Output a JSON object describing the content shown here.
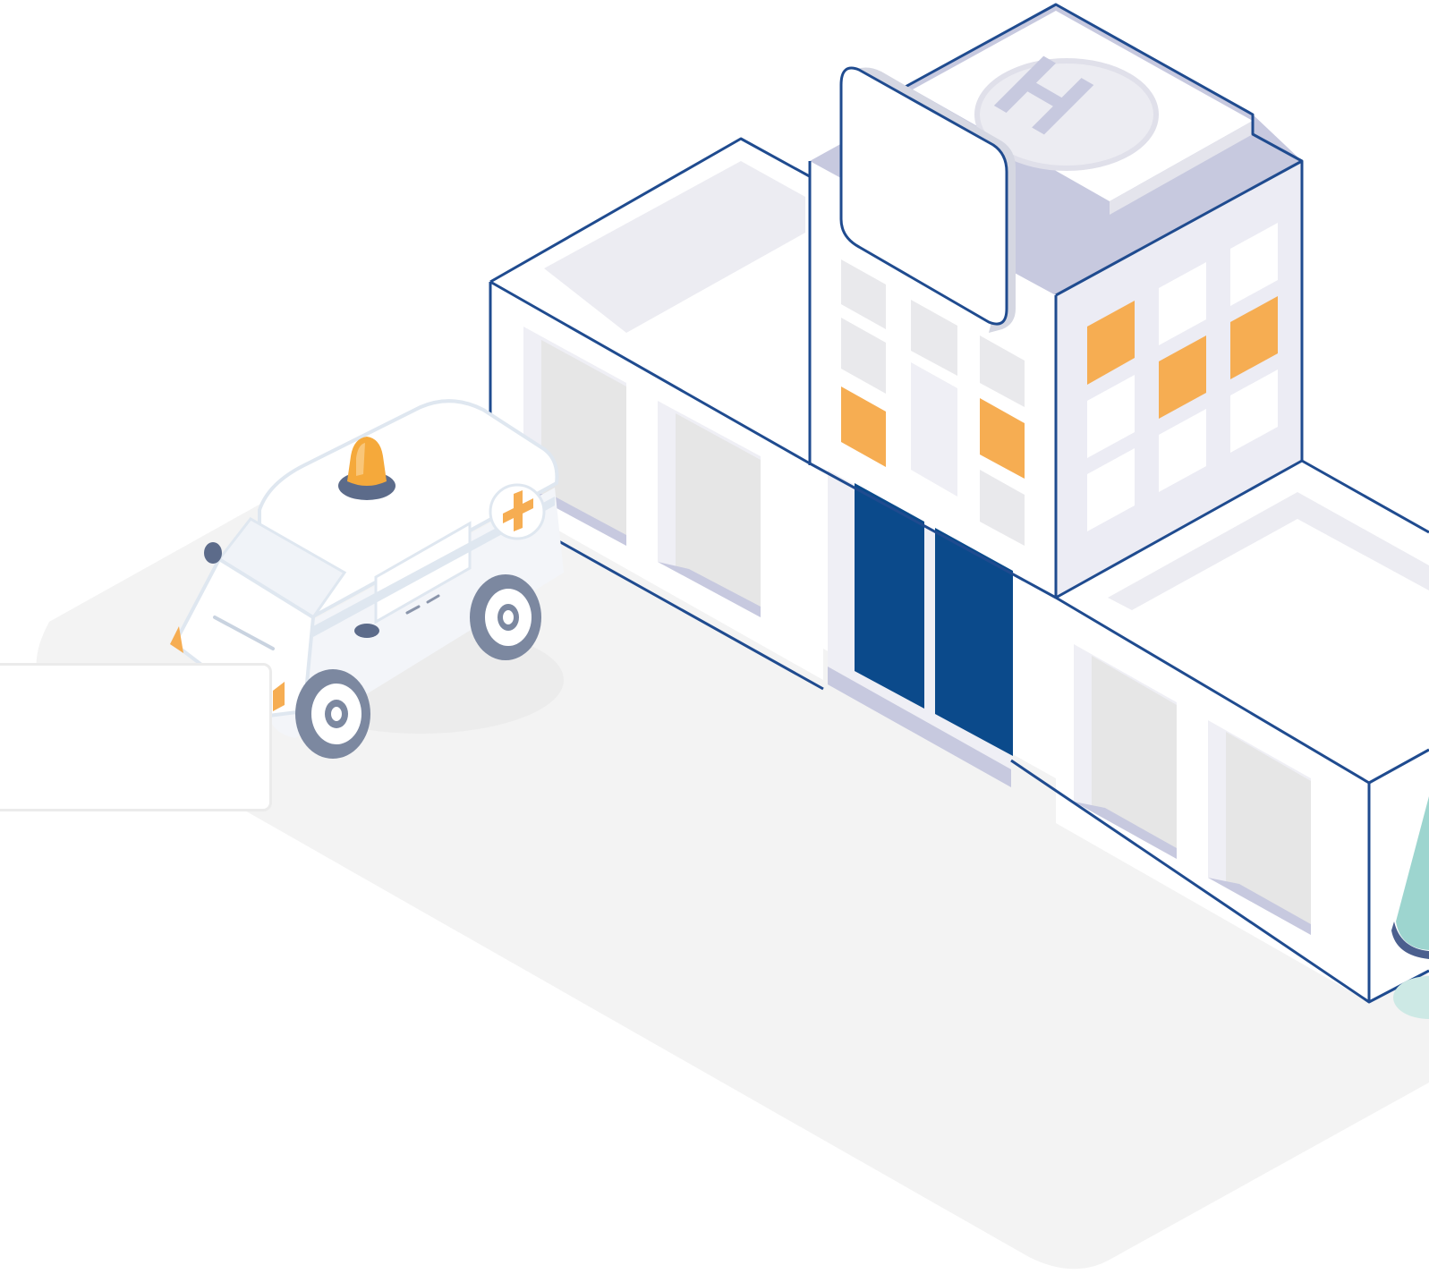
{
  "illustration": {
    "subject": "isometric-hospital",
    "elements": [
      "ground-shadow",
      "hospital-building",
      "helipad",
      "blank-sign",
      "ambulance",
      "blank-card",
      "tree-partial"
    ]
  },
  "helipad": {
    "letter": "H"
  },
  "colors": {
    "outline": "#1f4b8f",
    "door": "#0b4a8b",
    "window_lit": "#f6ad52",
    "window_glass": "#e9e9ec",
    "panel": "#efeff5",
    "shade": "#c7c9df",
    "ground": "#f3f3f3",
    "roof_light": "#ececf2",
    "ambulance_body": "#ffffff",
    "ambulance_trim": "#dfe7f0",
    "tire": "#7c88a0",
    "siren": "#f5a93b",
    "tree": "#9dd5cf"
  }
}
